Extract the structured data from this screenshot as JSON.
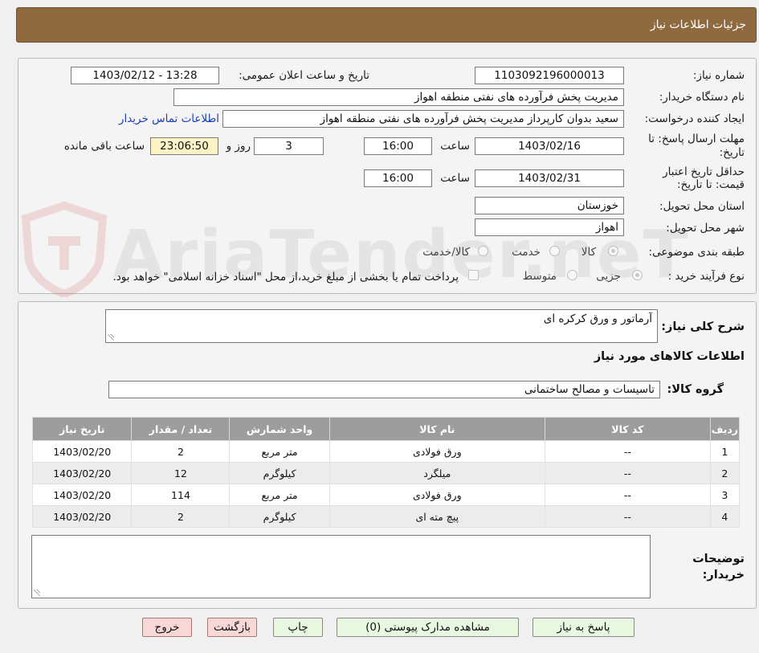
{
  "header": {
    "title": "جزئیات اطلاعات نیاز"
  },
  "form": {
    "need_number_label": "شماره نیاز:",
    "need_number": "1103092196000013",
    "announce_label": "تاریخ و ساعت اعلان عمومی:",
    "announce_value": "1403/02/12 - 13:28",
    "buyer_org_label": "نام دستگاه خریدار:",
    "buyer_org": "مدیریت پخش فرآورده های نفتی منطقه اهواز",
    "requester_label": "ایجاد کننده درخواست:",
    "requester": "سعید بدوان کارپرداز مدیریت پخش فرآورده های نفتی منطقه اهواز",
    "contact_link": "اطلاعات تماس خریدار",
    "deadline_label_1": "مهلت ارسال پاسخ: تا",
    "deadline_label_2": "تاریخ:",
    "deadline_date": "1403/02/16",
    "time_label": "ساعت",
    "deadline_time": "16:00",
    "days_value": "3",
    "days_label": "روز و",
    "remaining_time": "23:06:50",
    "remaining_label": "ساعت باقی مانده",
    "validity_label_1": "حداقل تاریخ اعتبار",
    "validity_label_2": "قیمت: تا تاریخ:",
    "validity_date": "1403/02/31",
    "validity_time": "16:00",
    "province_label": "استان محل تحویل:",
    "province": "خوزستان",
    "city_label": "شهر محل تحویل:",
    "city": "اهواز",
    "category_label": "طبقه بندی موضوعی:",
    "category_options": [
      "کالا",
      "خدمت",
      "کالا/خدمت"
    ],
    "process_label": "نوع فرآیند خرید :",
    "process_options": [
      "جزیی",
      "متوسط"
    ],
    "payment_note": "پرداخت تمام یا بخشی از مبلغ خرید،از محل \"اسناد خزانه اسلامی\" خواهد بود."
  },
  "need": {
    "summary_label": "شرح کلی نیاز:",
    "summary": "آرماتور و ورق کرکره ای",
    "goods_info_title": "اطلاعات کالاهای مورد نیاز",
    "group_label": "گروه کالا:",
    "group": "تاسیسات و مصالح ساختمانی"
  },
  "table": {
    "headers": [
      "ردیف",
      "کد کالا",
      "نام کالا",
      "واحد شمارش",
      "تعداد / مقدار",
      "تاریخ نیاز"
    ],
    "rows": [
      [
        "1",
        "--",
        "ورق فولادی",
        "متر مربع",
        "2",
        "1403/02/20"
      ],
      [
        "2",
        "--",
        "میلگرد",
        "کیلوگرم",
        "12",
        "1403/02/20"
      ],
      [
        "3",
        "--",
        "ورق فولادی",
        "متر مربع",
        "114",
        "1403/02/20"
      ],
      [
        "4",
        "--",
        "پیچ مته ای",
        "کیلوگرم",
        "2",
        "1403/02/20"
      ]
    ]
  },
  "notes": {
    "label_1": "توضیحات",
    "label_2": "خریدار:",
    "value": ""
  },
  "buttons": {
    "reply": "پاسخ به نیاز",
    "attachments": "مشاهده مدارک پیوستی (0)",
    "print": "چاپ",
    "back": "بازگشت",
    "exit": "خروج"
  },
  "watermark": {
    "text": "AriaTender.neT"
  },
  "colors": {
    "header_bg": "#8e6a3e",
    "table_header_bg": "#9d9d9d",
    "timer_bg": "#fdf3c4",
    "link": "#1c3fb0"
  }
}
